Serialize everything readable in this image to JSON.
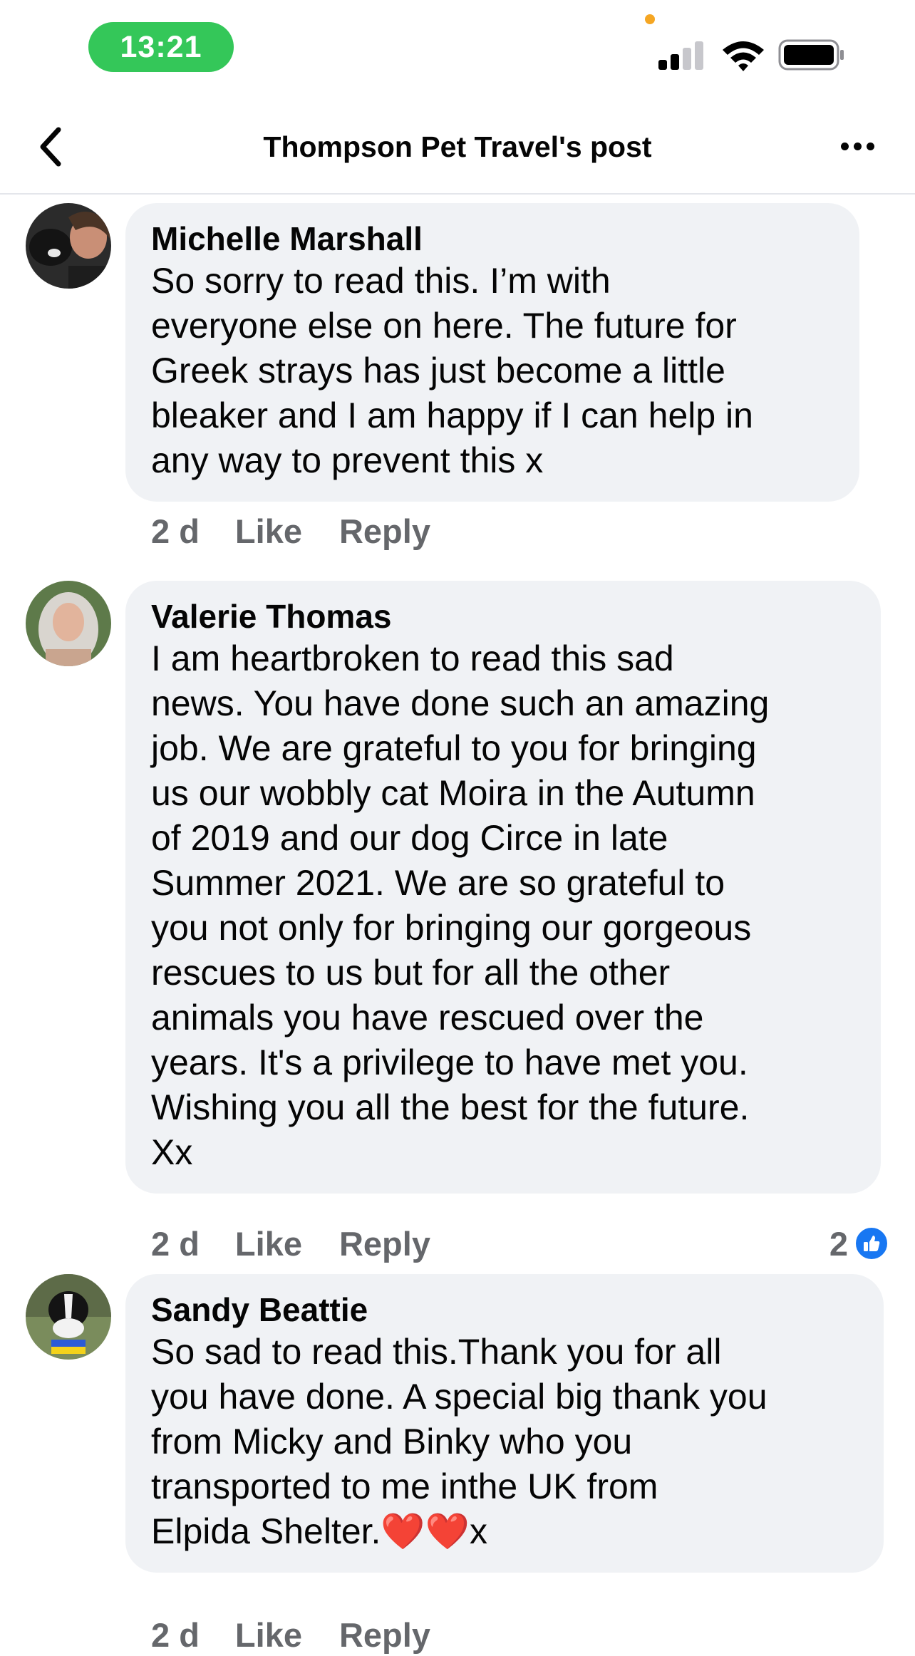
{
  "status_bar": {
    "time": "13:21",
    "colors": {
      "time_pill": "#34c759",
      "mic_dot": "#f5a623"
    }
  },
  "nav": {
    "title": "Thompson Pet Travel's post",
    "back_icon": "chevron-left-icon",
    "more_icon": "more-horizontal-icon"
  },
  "comments": [
    {
      "author": "Michelle Marshall",
      "text": "So sorry to read this.  I’m with\neveryone else on here.  The future for\nGreek strays has just become a little\nbleaker and I am happy if I can help in\nany way to prevent this x",
      "age": "2 d",
      "like_label": "Like",
      "reply_label": "Reply"
    },
    {
      "author": "Valerie Thomas",
      "text": "I am  heartbroken to read this sad\nnews. You have done such an amazing\njob. We are grateful to you for bringing\nus our wobbly cat Moira in the Autumn\nof 2019 and our dog Circe in late\nSummer 2021. We are so grateful to\nyou not only for bringing our gorgeous\nrescues to us but for all the other\nanimals you have rescued over the\nyears.  It's a privilege to have met you.\nWishing you all the best for the future.\nXx",
      "age": "2 d",
      "like_label": "Like",
      "reply_label": "Reply",
      "reaction_count": "2"
    },
    {
      "author": "Sandy Beattie",
      "text": "So sad to read this.Thank you for all\nyou have done. A special big thank you\nfrom Micky and Binky who you\ntransported to me inthe UK from\nElpida Shelter.❤️❤️x",
      "age": "2 d",
      "like_label": "Like",
      "reply_label": "Reply"
    }
  ],
  "colors": {
    "bubble": "#f0f2f5",
    "meta_text": "#65676b",
    "like_badge": "#1877f2"
  }
}
